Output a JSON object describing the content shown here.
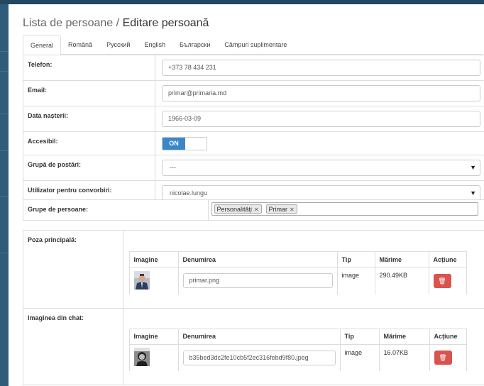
{
  "breadcrumb": {
    "parent": "Lista de persoane",
    "separator": "/",
    "current": "Editare persoană"
  },
  "tabs": [
    "General",
    "Română",
    "Русский",
    "English",
    "Български",
    "Câmpuri suplimentare"
  ],
  "active_tab": "General",
  "form": {
    "phone": {
      "label": "Telefon:",
      "value": "+373 78 434 231"
    },
    "email": {
      "label": "Email:",
      "value": "primar@primaria.md"
    },
    "birth": {
      "label": "Data nașterii:",
      "value": "1966-03-09"
    },
    "accessible": {
      "label": "Accesibil:",
      "value": "ON"
    },
    "post_group": {
      "label": "Grupă de postări:",
      "value": "---"
    },
    "chat_user": {
      "label": "Utilizator pentru convorbiri:",
      "value": "nicolae.lungu"
    }
  },
  "groups": {
    "label": "Grupe de persoane:",
    "tags": [
      "Personalități",
      "Primar"
    ]
  },
  "main_photo": {
    "label": "Poza principală:",
    "headers": [
      "Imagine",
      "Denumirea",
      "Tip",
      "Mărime",
      "Acțiune"
    ],
    "row": {
      "name": "primar.png",
      "type": "image",
      "size": "290.49KB"
    }
  },
  "chat_image": {
    "label": "Imaginea din chat:",
    "headers": [
      "Imagine",
      "Denumirea",
      "Tip",
      "Mărime",
      "Acțiune"
    ],
    "row": {
      "name": "b35bed3dc2fe10cb5f2ec316febd9f80.jpeg",
      "type": "image",
      "size": "16.07KB"
    }
  },
  "icons": {
    "delete": "trash-icon",
    "remove_tag": "close-icon",
    "dropdown": "caret-down-icon"
  },
  "colors": {
    "toggle_on": "#3a87c8",
    "delete": "#d9534f",
    "sidebar": "#2e5c7a"
  }
}
